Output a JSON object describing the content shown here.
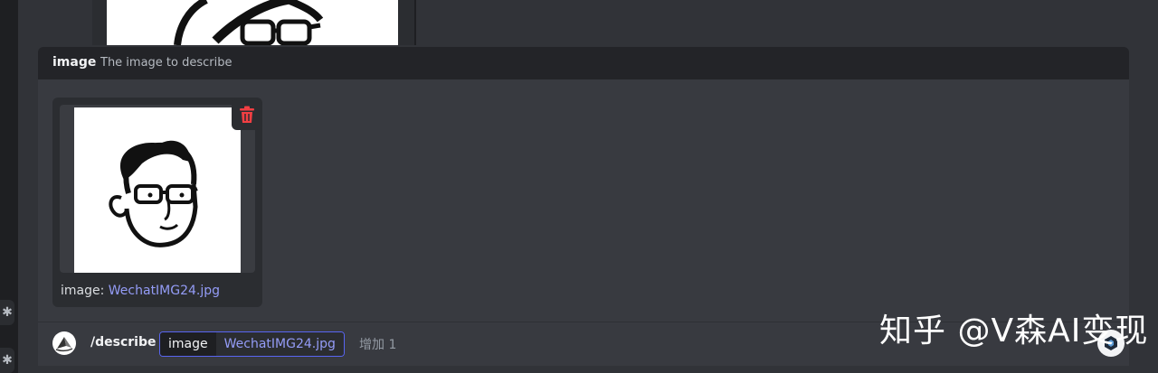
{
  "option": {
    "name": "image",
    "description": "The image to describe"
  },
  "attachment": {
    "caption_label": "image:",
    "filename": "WechatIMG24.jpg"
  },
  "composer": {
    "command": "/describe",
    "option_key": "image",
    "option_value": "WechatIMG24.jpg",
    "extra_options": "增加 1"
  },
  "watermark": "知乎 @V森AI变现",
  "colors": {
    "accent": "#5865f2",
    "link": "#949cf7",
    "danger": "#f23f43"
  },
  "icons": [
    "gear-icon",
    "trash-icon",
    "bot-avatar",
    "app-cube-icon"
  ]
}
